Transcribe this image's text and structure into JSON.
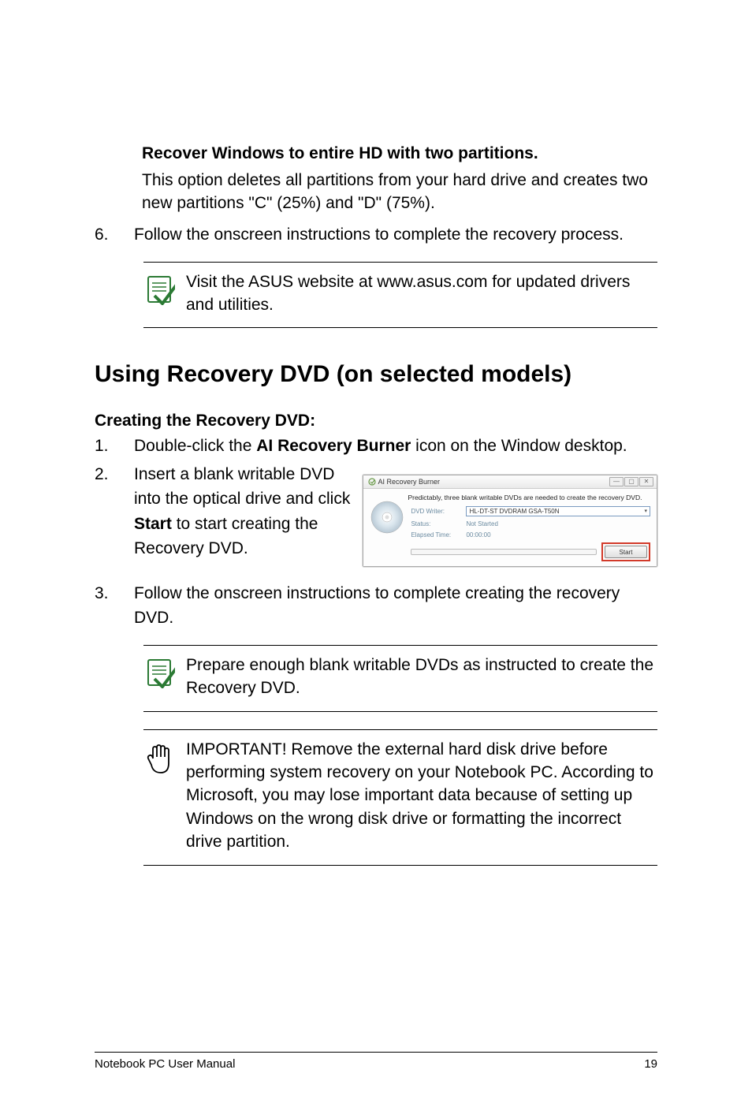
{
  "option": {
    "header": "Recover Windows to entire HD with two partitions.",
    "body": "This option deletes all partitions from your hard drive and creates two new partitions \"C\" (25%) and \"D\" (75%)."
  },
  "step6_num": "6.",
  "step6_text": "Follow the onscreen instructions to complete the recovery process.",
  "note1": "Visit the ASUS website at www.asus.com for updated drivers and utilities.",
  "section_title": "Using Recovery DVD (on selected models)",
  "sub_title": "Creating the Recovery DVD:",
  "step1": {
    "num": "1.",
    "pre": "Double-click the ",
    "bold": "AI Recovery Burner",
    "post": " icon on the Window desktop."
  },
  "step2": {
    "num": "2.",
    "pre": "Insert a blank writable DVD into the optical drive and click ",
    "bold": "Start",
    "post": " to start creating the Recovery DVD."
  },
  "step3": {
    "num": "3.",
    "text": "Follow the onscreen instructions to complete creating the recovery DVD."
  },
  "note2": "Prepare enough blank writable DVDs as instructed to create the Recovery DVD.",
  "note3": "IMPORTANT! Remove the external hard disk drive before performing system recovery on your Notebook PC. According to Microsoft, you may lose important data because of setting up Windows on the wrong disk drive or formatting the incorrect drive partition.",
  "ai_window": {
    "title": "AI Recovery Burner",
    "desc": "Predictably, three blank writable DVDs are needed to create the recovery DVD.",
    "dvd_writer_label": "DVD Writer:",
    "dvd_writer_value": "HL-DT-ST DVDRAM GSA-T50N",
    "status_label": "Status:",
    "status_value": "Not Started",
    "elapsed_label": "Elapsed Time:",
    "elapsed_value": "00:00:00",
    "start_label": "Start"
  },
  "footer": {
    "left": "Notebook PC User Manual",
    "right": "19"
  }
}
